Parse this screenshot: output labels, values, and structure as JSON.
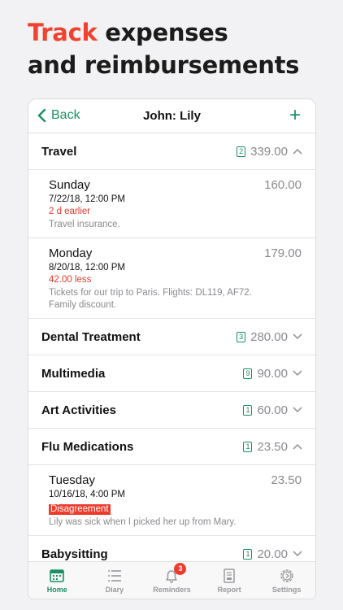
{
  "headline": {
    "accent": "Track",
    "line1_rest": "expenses",
    "line2": "and reimbursements"
  },
  "navbar": {
    "back_label": "Back",
    "title": "John: Lily",
    "add_label": "+"
  },
  "categories": [
    {
      "name": "Travel",
      "count": "2",
      "total": "339.00",
      "expanded": true
    },
    {
      "name": "Dental Treatment",
      "count": "3",
      "total": "280.00",
      "expanded": false
    },
    {
      "name": "Multimedia",
      "count": "9",
      "total": "90.00",
      "expanded": false
    },
    {
      "name": "Art Activities",
      "count": "1",
      "total": "60.00",
      "expanded": false
    },
    {
      "name": "Flu Medications",
      "count": "1",
      "total": "23.50",
      "expanded": true
    },
    {
      "name": "Babysitting",
      "count": "1",
      "total": "20.00",
      "expanded": false
    }
  ],
  "entries": {
    "travel": [
      {
        "day": "Sunday",
        "amount": "160.00",
        "date": "7/22/18, 12:00 PM",
        "status": "2 d earlier",
        "note1": "Travel insurance.",
        "note2": ""
      },
      {
        "day": "Monday",
        "amount": "179.00",
        "date": "8/20/18, 12:00 PM",
        "status": "42.00 less",
        "note1": "Tickets for our trip to Paris. Flights: DL119, AF72.",
        "note2": "Family discount."
      }
    ],
    "flu": [
      {
        "day": "Tuesday",
        "amount": "23.50",
        "date": "10/16/18, 4:00 PM",
        "status": "Disagreement",
        "note1": "Lily was sick when I picked her up from Mary."
      }
    ]
  },
  "tabs": [
    {
      "label": "Home",
      "icon": "home-icon"
    },
    {
      "label": "Diary",
      "icon": "list-icon"
    },
    {
      "label": "Reminders",
      "icon": "bell-icon",
      "badge": "3"
    },
    {
      "label": "Report",
      "icon": "report-icon"
    },
    {
      "label": "Settings",
      "icon": "settings-icon"
    }
  ],
  "colors": {
    "accent_red": "#f0422e",
    "brand_green": "#1a8f63",
    "warning_red": "#e0392b"
  }
}
